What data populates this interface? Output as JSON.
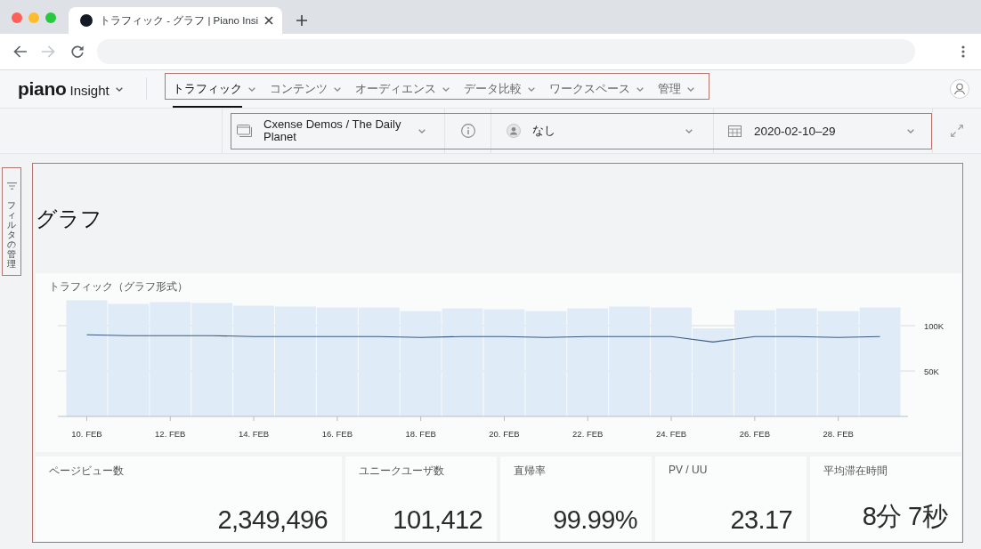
{
  "browser": {
    "tab_title": "トラフィック - グラフ | Piano Insi",
    "back_disabled": false,
    "forward_disabled": true
  },
  "header": {
    "logo": "piano",
    "product": "Insight",
    "nav": [
      {
        "label": "トラフィック",
        "selected": true
      },
      {
        "label": "コンテンツ",
        "selected": false
      },
      {
        "label": "オーディエンス",
        "selected": false
      },
      {
        "label": "データ比較",
        "selected": false
      },
      {
        "label": "ワークスペース",
        "selected": false
      },
      {
        "label": "管理",
        "selected": false
      }
    ]
  },
  "filter_bar": {
    "site": "Cxense Demos / The Daily Planet",
    "segment": "なし",
    "date_range": "2020-02-10–29"
  },
  "sidebar": {
    "filter_tab": "フィルタの管理"
  },
  "page": {
    "title": "グラフ",
    "chart": {
      "chart_data": {
        "type": "bar",
        "title": "トラフィック（グラフ形式）",
        "categories": [
          "10. FEB",
          null,
          "12. FEB",
          null,
          "14. FEB",
          null,
          "16. FEB",
          null,
          "18. FEB",
          null,
          "20. FEB",
          null,
          "22. FEB",
          null,
          "24. FEB",
          null,
          "26. FEB",
          null,
          "28. FEB",
          null
        ],
        "ylim": [
          0,
          130000
        ],
        "yticks": [
          {
            "value": 50000,
            "label": "50K"
          },
          {
            "value": 100000,
            "label": "100K"
          }
        ],
        "series": [
          {
            "color": "#dfebf7",
            "values": [
              128000,
              124000,
              126000,
              125000,
              122000,
              121000,
              120000,
              120000,
              116000,
              119000,
              118000,
              116000,
              119000,
              121000,
              120000,
              97000,
              117000,
              119000,
              116000,
              120000
            ]
          },
          {
            "type": "line",
            "color": "#3d5a80",
            "values": [
              90000,
              89000,
              89000,
              89000,
              88000,
              88000,
              88000,
              88000,
              87000,
              88000,
              88000,
              87000,
              88000,
              88000,
              88000,
              82000,
              88000,
              88000,
              87000,
              88000
            ]
          }
        ]
      }
    },
    "metrics": [
      {
        "label": "ページビュー数",
        "value": "2,349,496"
      },
      {
        "label": "ユニークユーザ数",
        "value": "101,412"
      },
      {
        "label": "直帰率",
        "value": "99.99%"
      },
      {
        "label": "PV / UU",
        "value": "23.17"
      },
      {
        "label": "平均滞在時間",
        "value": "8分 7秒"
      }
    ]
  }
}
